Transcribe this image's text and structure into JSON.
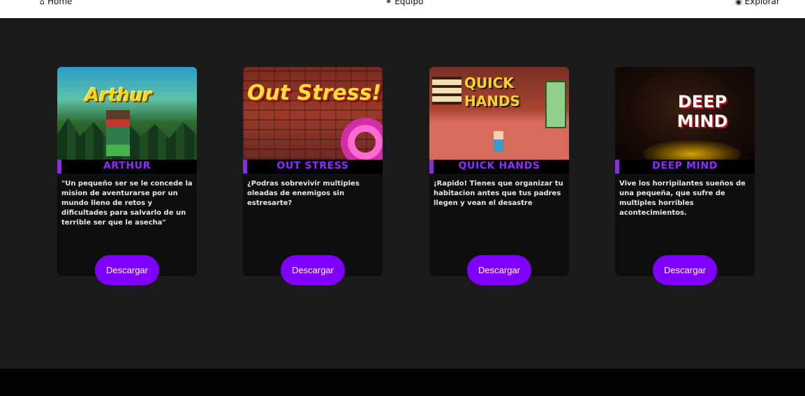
{
  "nav": {
    "home": {
      "icon": "home-icon",
      "label": "Home"
    },
    "team": {
      "icon": "globe-icon",
      "label": "Equipo"
    },
    "explore": {
      "icon": "eye-icon",
      "label": "Explorar"
    }
  },
  "colors": {
    "accent": "#8a2be2",
    "button": "#7f00ff",
    "page_bg": "#1a1a1a",
    "card_bg": "#0e0e0e"
  },
  "cards": [
    {
      "title": "ARTHUR",
      "thumb_text": "Arthur",
      "description": "\"Un pequeño ser se le concede la mision de aventurarse por un mundo lleno de retos y dificultades para salvarlo de un terrible ser que le asecha\"",
      "button": "Descargar"
    },
    {
      "title": "OUT STRESS",
      "thumb_text": "Out Stress!",
      "description": "¿Podras sobrevivir multiples oleadas de enemigos sin estresarte?",
      "button": "Descargar"
    },
    {
      "title": "QUICK HANDS",
      "thumb_text": "QUICK HANDS",
      "description": "¡Rapido! Tienes que organizar tu habitacion antes que tus padres llegen y vean el desastre",
      "button": "Descargar"
    },
    {
      "title": "DEEP MIND",
      "thumb_text": "DEEP MIND",
      "description": "Vive los horripilantes sueños de una pequeña, que sufre de multiples horribles acontecimientos.",
      "button": "Descargar"
    }
  ]
}
